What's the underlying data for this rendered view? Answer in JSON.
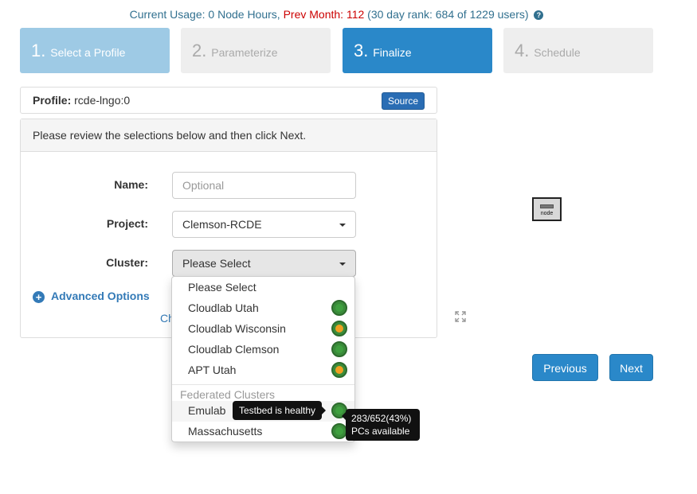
{
  "usage": {
    "current_label": "Current Usage:",
    "current_value": "0 Node Hours,",
    "prev_label": "Prev Month:",
    "prev_value": "112",
    "rank": "(30 day rank: 684 of 1229 users)"
  },
  "steps": [
    {
      "num": "1.",
      "label": "Select a Profile"
    },
    {
      "num": "2.",
      "label": "Parameterize"
    },
    {
      "num": "3.",
      "label": "Finalize"
    },
    {
      "num": "4.",
      "label": "Schedule"
    }
  ],
  "profile": {
    "label": "Profile:",
    "value": "rcde-lngo:0",
    "source_button": "Source"
  },
  "panel": {
    "instructions": "Please review the selections below and then click Next.",
    "name_label": "Name:",
    "name_placeholder": "Optional",
    "project_label": "Project:",
    "project_value": "Clemson-RCDE",
    "cluster_label": "Cluster:",
    "cluster_value": "Please Select",
    "advanced_options": "Advanced Options",
    "change_link_fragment": "Ch"
  },
  "dropdown": {
    "placeholder": "Please Select",
    "items": [
      "Cloudlab Utah",
      "Cloudlab Wisconsin",
      "Cloudlab Clemson",
      "APT Utah"
    ],
    "federated_header": "Federated Clusters",
    "federated_items": [
      "Emulab",
      "Massachusetts"
    ]
  },
  "tooltips": {
    "health": "Testbed is healthy",
    "availability_line1": "283/652(43%)",
    "availability_line2": "PCs available"
  },
  "topology": {
    "node_label": "node"
  },
  "buttons": {
    "previous": "Previous",
    "next": "Next"
  },
  "colors": {
    "accent": "#2a88c9",
    "status_green": "#3fa03f",
    "status_orange": "#f0a020",
    "prev_month": "#cc0000"
  }
}
